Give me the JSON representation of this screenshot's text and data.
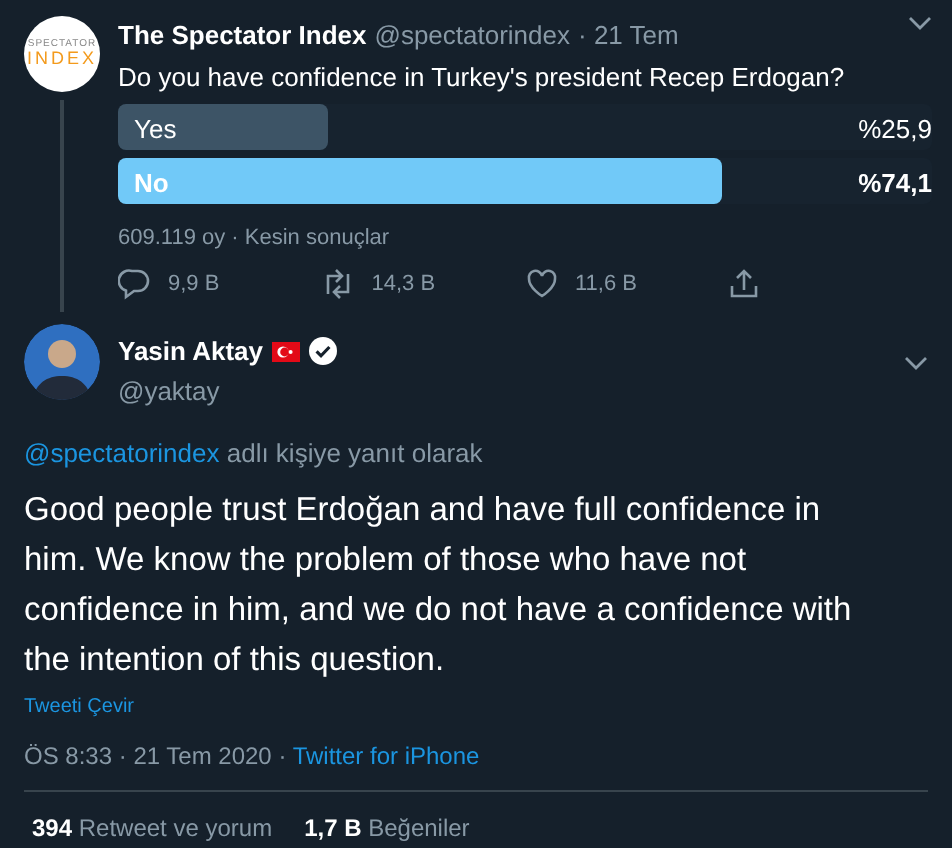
{
  "poll_tweet": {
    "logo_lines": [
      "SPECTATOR",
      "INDEX"
    ],
    "name": "The Spectator Index",
    "handle": "@spectatorindex",
    "date": "· 21 Tem",
    "question": "Do you have confidence in Turkey's president Recep Erdogan?",
    "options": [
      {
        "label": "Yes",
        "percent": "%25,9",
        "level": 0.259,
        "winner": false
      },
      {
        "label": "No",
        "percent": "%74,1",
        "level": 0.741,
        "winner": true
      }
    ],
    "votes": "609.119 oy · Kesin sonuçlar",
    "actions": [
      {
        "kind": "reply",
        "count": "9,9 B"
      },
      {
        "kind": "retweet",
        "count": "14,3 B"
      },
      {
        "kind": "like",
        "count": "11,6 B"
      },
      {
        "kind": "share"
      }
    ]
  },
  "reply_tweet": {
    "name": "Yasin Aktay",
    "handle": "@yaktay",
    "verified": true,
    "reply_to_mention": "@spectatorindex",
    "reply_to_text": "adlı kişiye yanıt olarak",
    "body": "Good people trust Erdoğan and have full confidence in him. We know the problem of those who have not confidence in him, and we do not have a confidence with the intention of this question.",
    "translate": "Tweeti Çevir",
    "timestamp": "ÖS 8:33 · 21 Tem 2020 ·",
    "source": "Twitter for iPhone",
    "stats": [
      {
        "count": "394",
        "label": "Retweet ve yorum"
      },
      {
        "count": "1,7 B",
        "label": "Beğeniler"
      }
    ]
  }
}
